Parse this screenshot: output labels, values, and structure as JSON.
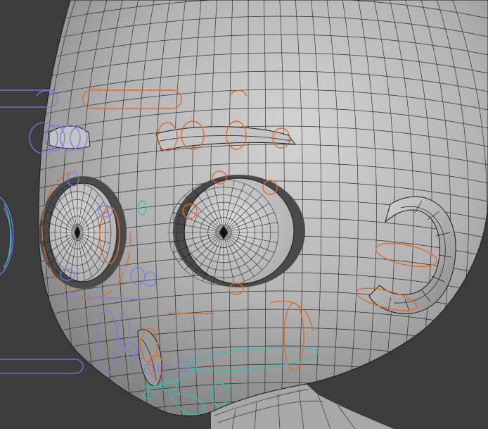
{
  "viewport": {
    "background": "#3c3c3c",
    "mesh_fill": "#b9b9b9",
    "wire_color": "#1a1a1a",
    "eye_fill": "#c8c8c8"
  },
  "rig_controls": {
    "colors": {
      "face": "#e06a2a",
      "left_side": "#7b7be0",
      "jaw": "#2bc3b5"
    }
  }
}
